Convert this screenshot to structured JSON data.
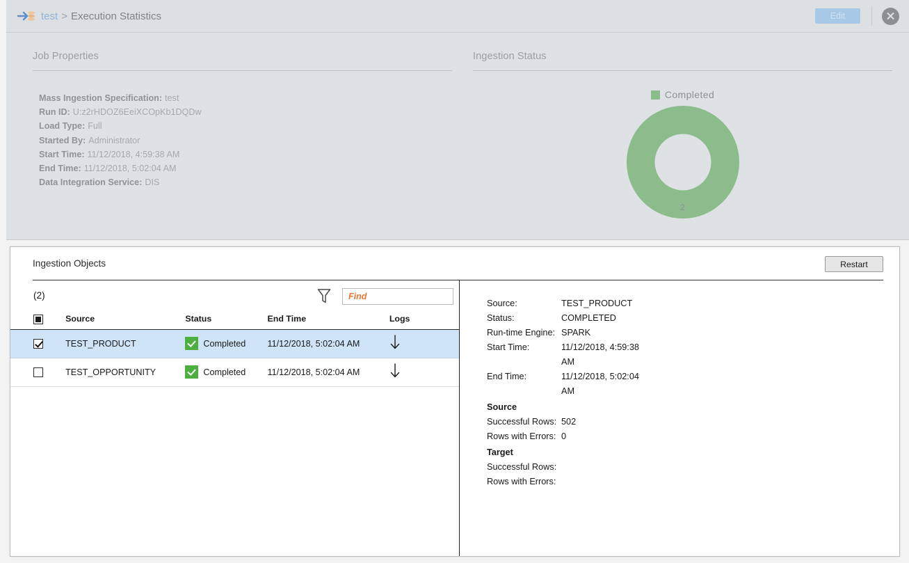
{
  "titlebar": {
    "app_icon": "mass-ingestion-icon",
    "breadcrumb_root": "test",
    "breadcrumb_separator": ">",
    "breadcrumb_current": "Execution Statistics",
    "edit_label": "Edit",
    "close_icon": "close-icon"
  },
  "job_properties": {
    "title": "Job Properties",
    "rows": [
      {
        "key": "Mass Ingestion Specification:",
        "value": "test"
      },
      {
        "key": "Run ID:",
        "value": "U:z2rHDOZ6EeiXCOpKb1DQDw"
      },
      {
        "key": "Load Type:",
        "value": "Full"
      },
      {
        "key": "Started By:",
        "value": "Administrator"
      },
      {
        "key": "Start Time:",
        "value": "11/12/2018, 4:59:38 AM"
      },
      {
        "key": "End Time:",
        "value": "11/12/2018, 5:02:04 AM"
      },
      {
        "key": "Data Integration Service:",
        "value": "DIS"
      }
    ]
  },
  "ingestion_status": {
    "title": "Ingestion Status",
    "legend_label": "Completed",
    "center_count": "2"
  },
  "chart_data": {
    "type": "pie",
    "title": "Ingestion Status",
    "categories": [
      "Completed"
    ],
    "values": [
      2
    ],
    "colors": [
      "#8cbc8c"
    ],
    "total": 2,
    "donut": true,
    "inner_radius_ratio": 0.5,
    "legend_position": "top",
    "data_labels": [
      "2"
    ]
  },
  "ingestion_objects": {
    "title": "Ingestion Objects",
    "restart_label": "Restart",
    "count_label": "(2)",
    "filter_icon": "filter-funnel-icon",
    "find_placeholder": "Find",
    "find_value": "",
    "columns": [
      "Source",
      "Status",
      "End Time",
      "Logs"
    ],
    "header_checkbox_state": "partial",
    "rows": [
      {
        "checked": true,
        "selected": true,
        "source": "TEST_PRODUCT",
        "status": "Completed",
        "end_time": "11/12/2018, 5:02:04 AM",
        "log_icon": "download-arrow-icon"
      },
      {
        "checked": false,
        "selected": false,
        "source": "TEST_OPPORTUNITY",
        "status": "Completed",
        "end_time": "11/12/2018, 5:02:04 AM",
        "log_icon": "download-arrow-icon"
      }
    ]
  },
  "object_detail": {
    "rows": [
      {
        "key": "Source:",
        "value": "TEST_PRODUCT"
      },
      {
        "key": "Status:",
        "value": "COMPLETED"
      },
      {
        "key": "Run-time Engine:",
        "value": "SPARK"
      },
      {
        "key": "Start Time:",
        "value": "11/12/2018, 4:59:38 AM"
      },
      {
        "key": "End Time:",
        "value": "11/12/2018, 5:02:04 AM"
      }
    ],
    "source_section": "Source",
    "source_rows": [
      {
        "key": "Successful Rows:",
        "value": "502"
      },
      {
        "key": "Rows with Errors:",
        "value": "0"
      }
    ],
    "target_section": "Target",
    "target_rows": [
      {
        "key": "Successful Rows:",
        "value": ""
      },
      {
        "key": "Rows with Errors:",
        "value": ""
      }
    ]
  },
  "colors": {
    "donut_green": "#8cbc8c",
    "status_green": "#4caf3f",
    "selected_row_blue": "#d0e4f7",
    "accent_orange": "#e8762c",
    "panel_gray": "#dfe2e5"
  }
}
